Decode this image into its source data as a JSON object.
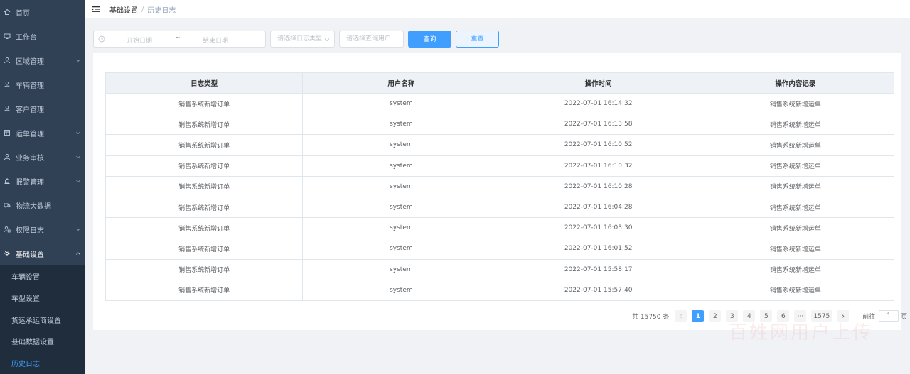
{
  "sidebar": {
    "items": [
      {
        "label": "首页",
        "icon": "home-icon",
        "has_arrow": false
      },
      {
        "label": "工作台",
        "icon": "monitor-icon",
        "has_arrow": false
      },
      {
        "label": "区域管理",
        "icon": "user-icon",
        "has_arrow": true
      },
      {
        "label": "车辆管理",
        "icon": "user-icon",
        "has_arrow": false
      },
      {
        "label": "客户管理",
        "icon": "user-icon",
        "has_arrow": false
      },
      {
        "label": "运单管理",
        "icon": "table-icon",
        "has_arrow": true
      },
      {
        "label": "业务审核",
        "icon": "user-icon",
        "has_arrow": true
      },
      {
        "label": "报警管理",
        "icon": "alarm-icon",
        "has_arrow": true
      },
      {
        "label": "物流大数据",
        "icon": "truck-icon",
        "has_arrow": false
      },
      {
        "label": "权限日志",
        "icon": "user-lock-icon",
        "has_arrow": true
      },
      {
        "label": "基础设置",
        "icon": "gear-icon",
        "has_arrow": true
      }
    ],
    "sub_items": [
      {
        "label": "车辆设置"
      },
      {
        "label": "车型设置"
      },
      {
        "label": "货运承运商设置"
      },
      {
        "label": "基础数据设置"
      },
      {
        "label": "历史日志"
      }
    ],
    "accent_color": "#409eff",
    "background": "#304156"
  },
  "header": {
    "breadcrumb_parent": "基础设置",
    "breadcrumb_separator": "/",
    "breadcrumb_current": "历史日志"
  },
  "filter": {
    "start_placeholder": "开始日期",
    "range_separator": "~",
    "end_placeholder": "结束日期",
    "type_placeholder": "请选择日志类型",
    "user_placeholder": "请选择查询用户",
    "query_label": "查询",
    "reset_label": "重置"
  },
  "table": {
    "headers": [
      "日志类型",
      "用户名称",
      "操作时间",
      "操作内容记录"
    ],
    "rows": [
      [
        "销售系统新增订单",
        "system",
        "2022-07-01 16:14:32",
        "销售系统新增运单"
      ],
      [
        "销售系统新增订单",
        "system",
        "2022-07-01 16:13:58",
        "销售系统新增运单"
      ],
      [
        "销售系统新增订单",
        "system",
        "2022-07-01 16:10:52",
        "销售系统新增运单"
      ],
      [
        "销售系统新增订单",
        "system",
        "2022-07-01 16:10:32",
        "销售系统新增运单"
      ],
      [
        "销售系统新增订单",
        "system",
        "2022-07-01 16:10:28",
        "销售系统新增运单"
      ],
      [
        "销售系统新增订单",
        "system",
        "2022-07-01 16:04:28",
        "销售系统新增运单"
      ],
      [
        "销售系统新增订单",
        "system",
        "2022-07-01 16:03:30",
        "销售系统新增运单"
      ],
      [
        "销售系统新增订单",
        "system",
        "2022-07-01 16:01:52",
        "销售系统新增运单"
      ],
      [
        "销售系统新增订单",
        "system",
        "2022-07-01 15:58:17",
        "销售系统新增运单"
      ],
      [
        "销售系统新增订单",
        "system",
        "2022-07-01 15:57:40",
        "销售系统新增运单"
      ]
    ]
  },
  "pagination": {
    "total_text": "共 15750 条",
    "pages": [
      "1",
      "2",
      "3",
      "4",
      "5",
      "6",
      "···",
      "1575"
    ],
    "current": "1",
    "goto_prefix": "前往",
    "goto_value": "1",
    "goto_suffix": "页"
  },
  "watermark": "百姓网用户上传"
}
